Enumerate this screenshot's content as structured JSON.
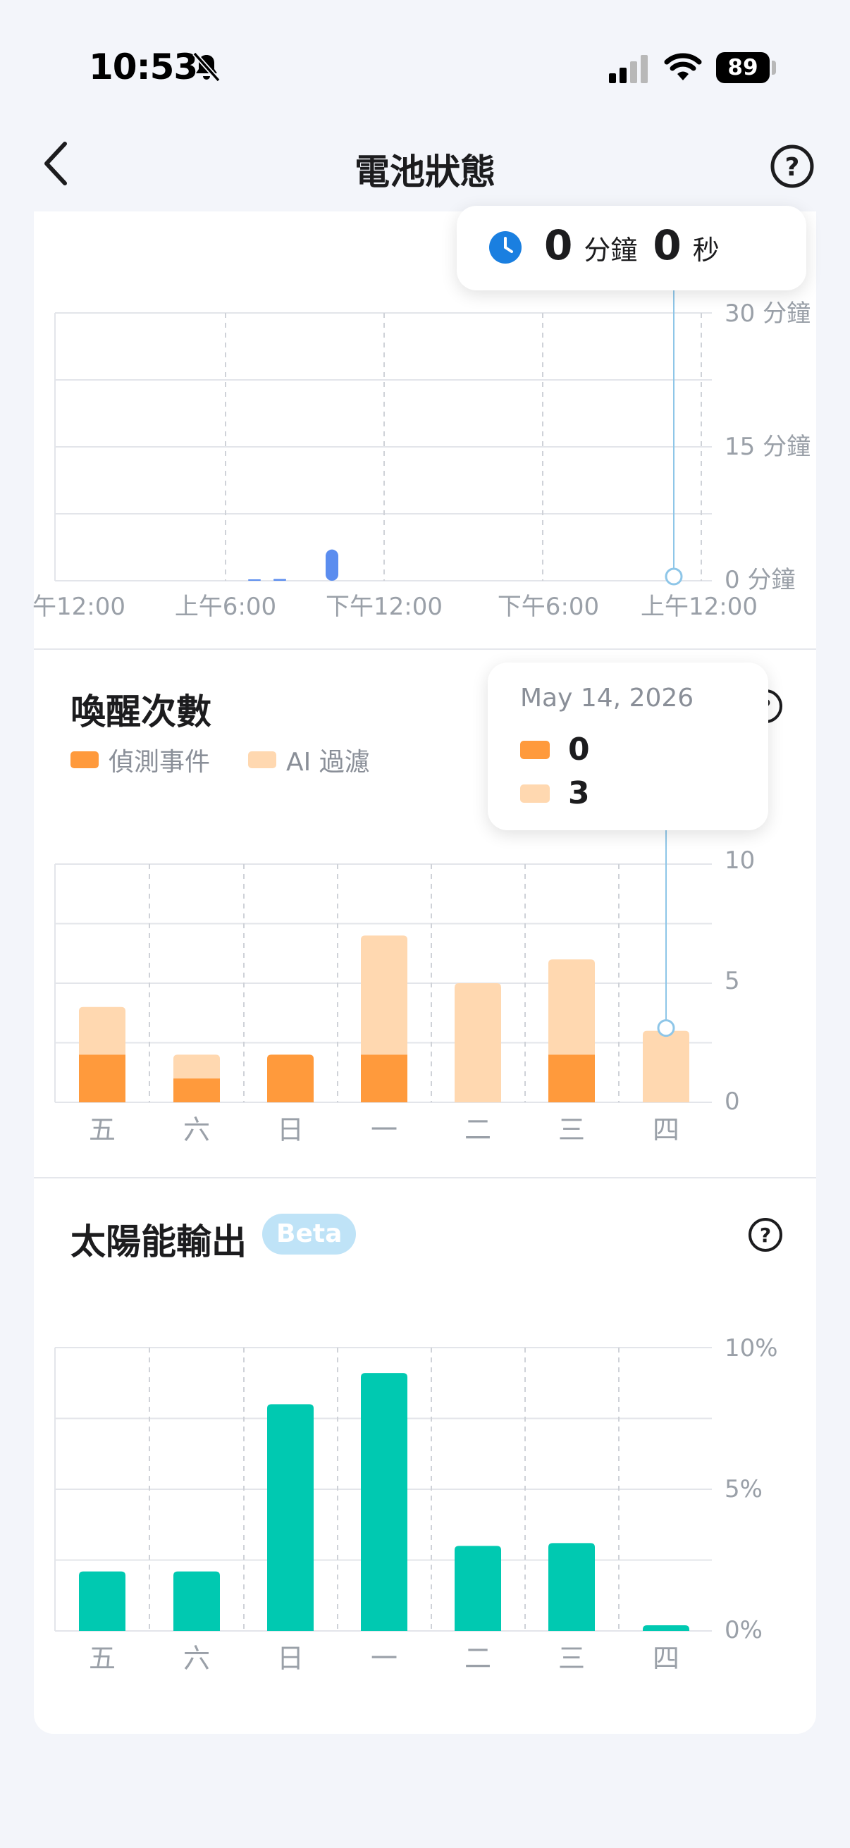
{
  "status_bar": {
    "time": "10:53",
    "battery": "89"
  },
  "nav": {
    "title": "電池狀態"
  },
  "usage_chart": {
    "tooltip": {
      "minutes": "0",
      "minutes_unit": "分鐘",
      "seconds": "0",
      "seconds_unit": "秒"
    }
  },
  "wakeup_section": {
    "title": "喚醒次數",
    "legend": {
      "detection": "偵測事件",
      "ai_filter": "AI 過濾"
    },
    "tooltip": {
      "date": "May 14, 2026",
      "detection_value": "0",
      "ai_filter_value": "3"
    }
  },
  "solar_section": {
    "title": "太陽能輸出",
    "badge": "Beta"
  },
  "colors": {
    "accent_blue": "#1a7fe0",
    "usage_bar": "#5b8def",
    "detection": "#ff9a3c",
    "ai_filter": "#ffd8b0",
    "solar": "#00c9b1",
    "tooltip_line": "#8ec6e8"
  },
  "chart_data": [
    {
      "type": "bar",
      "title": "",
      "x_tick_labels": [
        "午12:00",
        "上午6:00",
        "下午12:00",
        "下午6:00",
        "上午12:00"
      ],
      "y_tick_labels": [
        "30 分鐘",
        "15 分鐘",
        "0 分鐘"
      ],
      "ylim": [
        0,
        30
      ],
      "series": [
        {
          "values_minutes": [
            {
              "t": "上午5:00",
              "v": 0.1
            },
            {
              "t": "上午7:30",
              "v": 0.2
            },
            {
              "t": "上午11:00",
              "v": 3.5
            }
          ]
        }
      ],
      "grid": true
    },
    {
      "type": "bar",
      "stacked": true,
      "title": "喚醒次數",
      "categories": [
        "五",
        "六",
        "日",
        "一",
        "二",
        "三",
        "四"
      ],
      "y_tick_labels": [
        "10",
        "5",
        "0"
      ],
      "ylim": [
        0,
        10
      ],
      "series": [
        {
          "name": "偵測事件",
          "values": [
            2,
            1,
            2,
            2,
            0,
            2,
            0
          ]
        },
        {
          "name": "AI 過濾",
          "values": [
            2,
            1,
            0,
            5,
            5,
            4,
            3
          ]
        }
      ],
      "legend": "top-left",
      "grid": true
    },
    {
      "type": "bar",
      "title": "太陽能輸出",
      "categories": [
        "五",
        "六",
        "日",
        "一",
        "二",
        "三",
        "四"
      ],
      "y_tick_labels": [
        "10%",
        "5%",
        "0%"
      ],
      "ylim": [
        0,
        10
      ],
      "values": [
        2.1,
        2.1,
        8.0,
        9.1,
        3.0,
        3.1,
        0.2
      ],
      "grid": true
    }
  ]
}
